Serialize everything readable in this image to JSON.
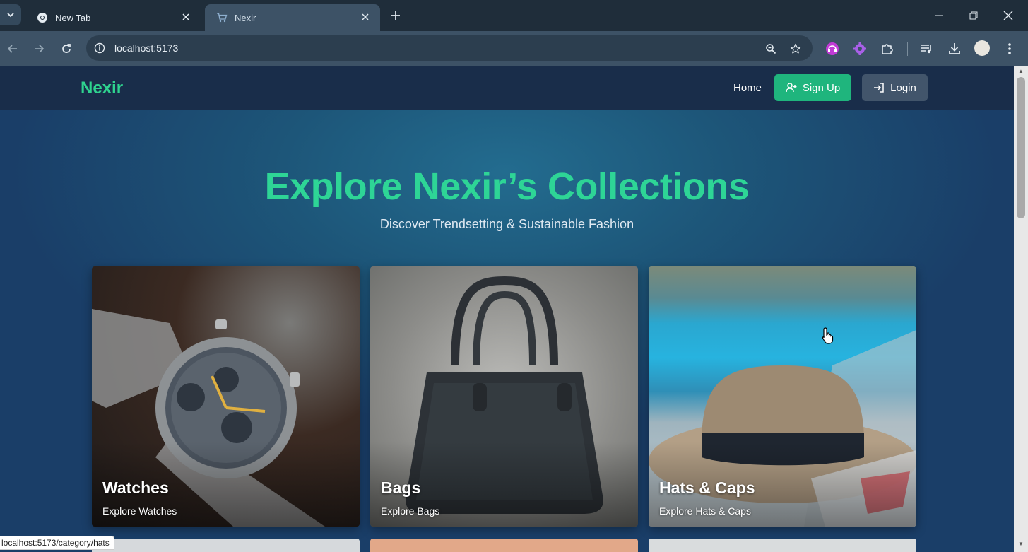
{
  "browser": {
    "tabs": [
      {
        "title": "New Tab",
        "icon": "chrome-icon",
        "active": false
      },
      {
        "title": "Nexir",
        "icon": "cart-icon",
        "active": true
      }
    ],
    "url": "localhost:5173",
    "status_url": "localhost:5173/category/hats"
  },
  "header": {
    "brand": "Nexir",
    "home": "Home",
    "signup": "Sign Up",
    "login": "Login"
  },
  "hero": {
    "title": "Explore Nexir’s Collections",
    "subtitle": "Discover Trendsetting & Sustainable Fashion"
  },
  "categories": [
    {
      "title": "Watches",
      "link": "Explore Watches"
    },
    {
      "title": "Bags",
      "link": "Explore Bags"
    },
    {
      "title": "Hats & Caps",
      "link": "Explore Hats & Caps"
    }
  ],
  "colors": {
    "brand_accent": "#2fd38f",
    "signup_button": "#1fb57d",
    "login_button": "#42556b",
    "header_bg": "#192d4a"
  }
}
